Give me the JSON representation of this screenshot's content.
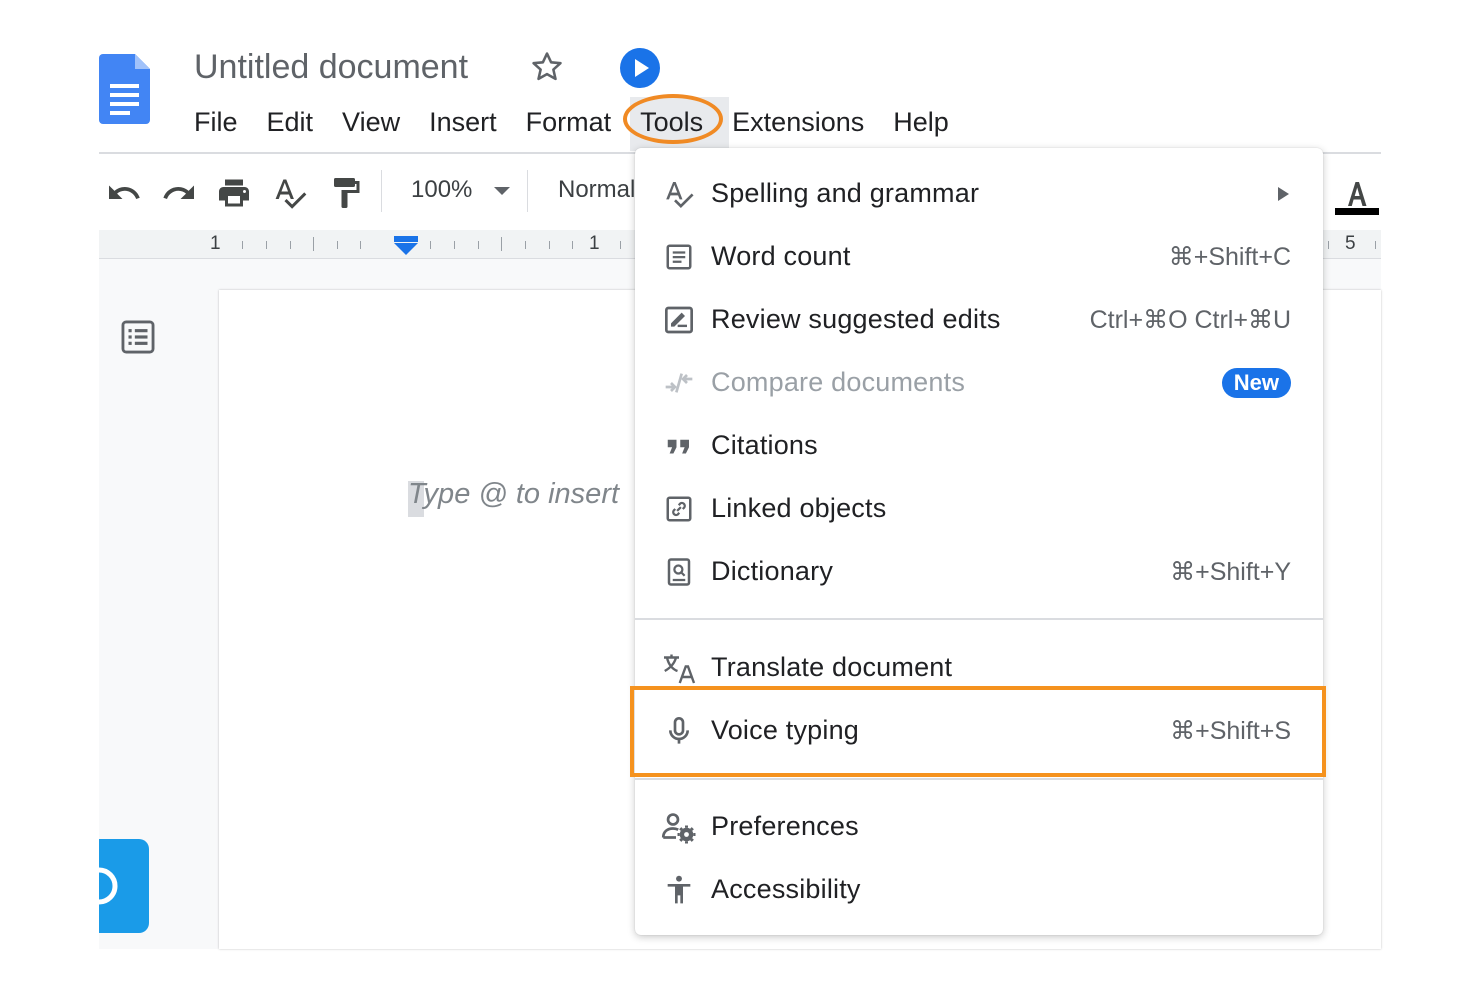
{
  "header": {
    "title": "Untitled document",
    "menu": [
      "File",
      "Edit",
      "View",
      "Insert",
      "Format",
      "Tools",
      "Extensions",
      "Help"
    ],
    "highlighted_menu": "Tools"
  },
  "toolbar": {
    "zoom": "100%",
    "style": "Normal",
    "icons": [
      "undo-icon",
      "redo-icon",
      "print-icon",
      "spellcheck-icon",
      "paint-format-icon",
      "text-color-icon"
    ]
  },
  "ruler": {
    "left_number": "1",
    "mid_number": "1",
    "right_number": "5"
  },
  "document": {
    "placeholder": "Type @ to insert"
  },
  "tools_menu": {
    "items": [
      {
        "label": "Spelling and grammar",
        "shortcut": "",
        "icon": "spelling-icon",
        "submenu": true
      },
      {
        "label": "Word count",
        "shortcut": "⌘+Shift+C",
        "icon": "word-count-icon"
      },
      {
        "label": "Review suggested edits",
        "shortcut": "Ctrl+⌘O Ctrl+⌘U",
        "icon": "review-edits-icon"
      },
      {
        "label": "Compare documents",
        "shortcut": "",
        "badge": "New",
        "icon": "compare-icon",
        "disabled": true
      },
      {
        "label": "Citations",
        "shortcut": "",
        "icon": "quote-icon"
      },
      {
        "label": "Linked objects",
        "shortcut": "",
        "icon": "link-icon"
      },
      {
        "label": "Dictionary",
        "shortcut": "⌘+Shift+Y",
        "icon": "dictionary-icon"
      },
      {
        "label": "Translate document",
        "shortcut": "",
        "icon": "translate-icon"
      },
      {
        "label": "Voice typing",
        "shortcut": "⌘+Shift+S",
        "icon": "microphone-icon",
        "highlighted": true
      },
      {
        "label": "Preferences",
        "shortcut": "",
        "icon": "preferences-icon"
      },
      {
        "label": "Accessibility",
        "shortcut": "",
        "icon": "accessibility-icon"
      }
    ]
  },
  "colors": {
    "accent_blue": "#1a73e8",
    "highlight_orange": "#f5921e",
    "side_widget": "#1a9be8"
  }
}
